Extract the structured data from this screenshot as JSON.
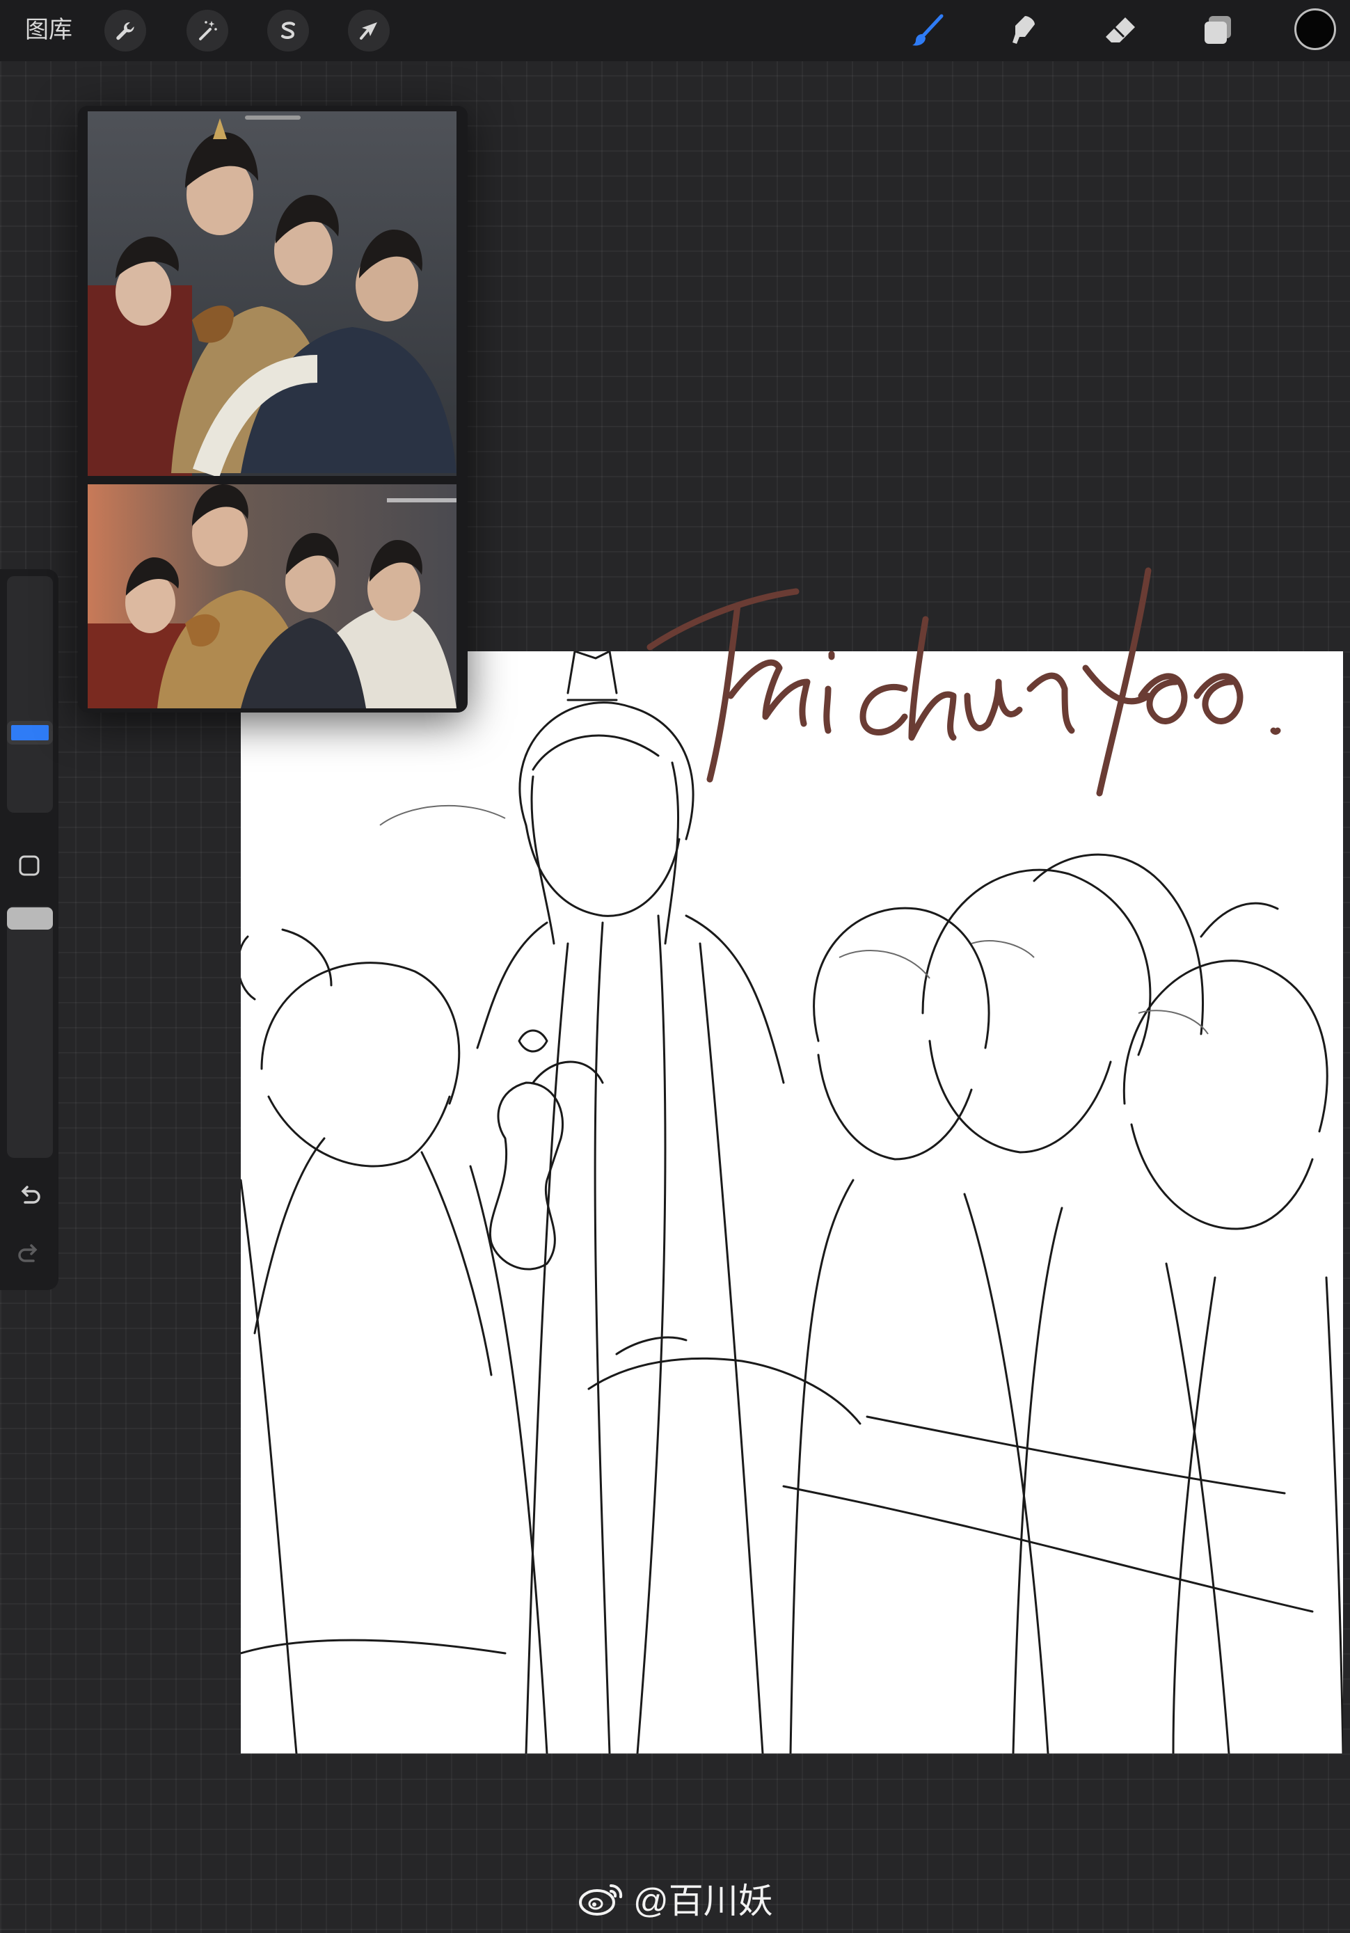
{
  "toolbar": {
    "gallery_label": "图库",
    "left_tools": [
      {
        "name": "actions",
        "icon": "wrench-icon"
      },
      {
        "name": "adjustments",
        "icon": "magic-wand-icon"
      },
      {
        "name": "selection",
        "icon": "selection-s-icon"
      },
      {
        "name": "transform",
        "icon": "arrow-cursor-icon"
      }
    ],
    "right_tools": [
      {
        "name": "brush",
        "icon": "brush-icon",
        "active": true
      },
      {
        "name": "smudge",
        "icon": "smudge-icon"
      },
      {
        "name": "eraser",
        "icon": "eraser-icon"
      },
      {
        "name": "layers",
        "icon": "layers-icon"
      }
    ],
    "active_color": "#050505",
    "accent_color": "#2f7cf6"
  },
  "sidebar": {
    "brush_size_level": 0.62,
    "opacity_level": 0.97,
    "buttons": [
      {
        "name": "modify-button",
        "icon": "square-icon"
      },
      {
        "name": "undo-button",
        "icon": "undo-icon"
      },
      {
        "name": "redo-button",
        "icon": "redo-icon"
      }
    ]
  },
  "reference_window": {
    "photos": [
      {
        "name": "reference-photo-1",
        "description_icon": "photo-icon"
      },
      {
        "name": "reference-photo-2",
        "description_icon": "photo-icon"
      }
    ]
  },
  "canvas": {
    "signature_color": "#6a3c34",
    "signature_text": "Baichuanyao"
  },
  "watermark": {
    "text": "@百川妖",
    "icon": "weibo-icon"
  }
}
